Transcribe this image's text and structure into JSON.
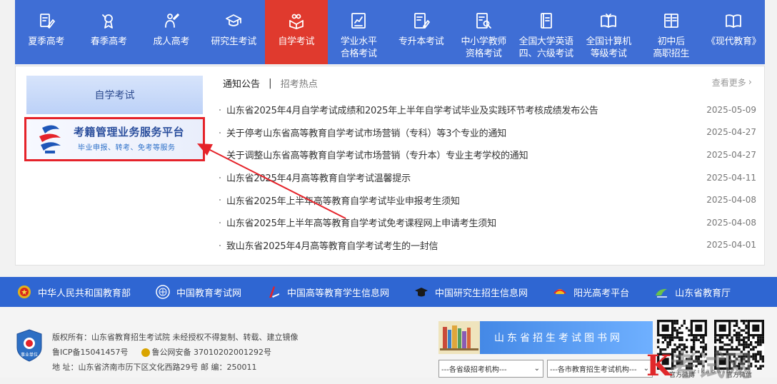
{
  "nav": {
    "items": [
      {
        "label": "夏季高考",
        "icon": "form-pen-icon"
      },
      {
        "label": "春季高考",
        "icon": "award-icon"
      },
      {
        "label": "成人高考",
        "icon": "person-pen-icon"
      },
      {
        "label": "研究生考试",
        "icon": "graduation-cap-icon"
      },
      {
        "label": "自学考试",
        "icon": "self-study-icon",
        "active": true
      },
      {
        "label": "学业水平\n合格考试",
        "icon": "chart-doc-icon"
      },
      {
        "label": "专升本考试",
        "icon": "edit-doc-icon"
      },
      {
        "label": "中小学教师\n资格考试",
        "icon": "search-doc-icon"
      },
      {
        "label": "全国大学英语\n四、六级考试",
        "icon": "book-icon"
      },
      {
        "label": "全国计算机\n等级考试",
        "icon": "open-book-icon"
      },
      {
        "label": "初中后\n高职招生",
        "icon": "school-book-icon"
      },
      {
        "label": "《现代教育》",
        "icon": "magazine-icon"
      }
    ],
    "active_color": "#e03a2e",
    "bg_color": "#3f6ed5"
  },
  "sidebar": {
    "title": "自学考试",
    "banner_title": "考籍管理业务服务平台",
    "banner_subtitle": "毕业申报、转考、免考等服务"
  },
  "notices": {
    "tab_active": "通知公告",
    "tab_other": "招考热点",
    "more": "查看更多",
    "items": [
      {
        "title": "山东省2025年4月自学考试成绩和2025年上半年自学考试毕业及实践环节考核成绩发布公告",
        "date": "2025-05-09"
      },
      {
        "title": "关于停考山东省高等教育自学考试市场营销（专科）等3个专业的通知",
        "date": "2025-04-27"
      },
      {
        "title": "关于调整山东省高等教育自学考试市场营销（专升本）专业主考学校的通知",
        "date": "2025-04-27"
      },
      {
        "title": "山东省2025年4月高等教育自学考试温馨提示",
        "date": "2025-04-11"
      },
      {
        "title": "山东省2025年上半年高等教育自学考试毕业申报考生须知",
        "date": "2025-04-08"
      },
      {
        "title": "山东省2025年上半年高等教育自学考试免考课程网上申请考生须知",
        "date": "2025-04-08"
      },
      {
        "title": "致山东省2025年4月高等教育自学考试考生的一封信",
        "date": "2025-04-01"
      }
    ]
  },
  "links": {
    "items": [
      {
        "label": "中华人民共和国教育部",
        "icon": "national-emblem-icon"
      },
      {
        "label": "中国教育考试网",
        "icon": "exam-seal-icon"
      },
      {
        "label": "中国高等教育学生信息网",
        "icon": "chsi-logo-icon"
      },
      {
        "label": "中国研究生招生信息网",
        "icon": "mortarboard-icon"
      },
      {
        "label": "阳光高考平台",
        "icon": "sunshine-icon"
      },
      {
        "label": "山东省教育厅",
        "icon": "edu-dept-icon"
      }
    ]
  },
  "footer": {
    "badge_text": "事业单位",
    "copyright": "版权所有：山东省教育招生考试院 未经授权不得复制、转载、建立镜像",
    "icp": "鲁ICP备15041457号",
    "police": "鲁公网安备 37010202001292号",
    "address": "地  址：山东省济南市历下区文化西路29号 邮  编：250011",
    "library": "山东省招生考试图书网",
    "select_province": "---各省级招考机构---",
    "select_city": "---各市教育招生考试机构---",
    "qr1_caption": "官方微博",
    "qr2_caption": "官方微信"
  },
  "watermark": {
    "text": "考试网",
    "url": "zikaowin"
  }
}
